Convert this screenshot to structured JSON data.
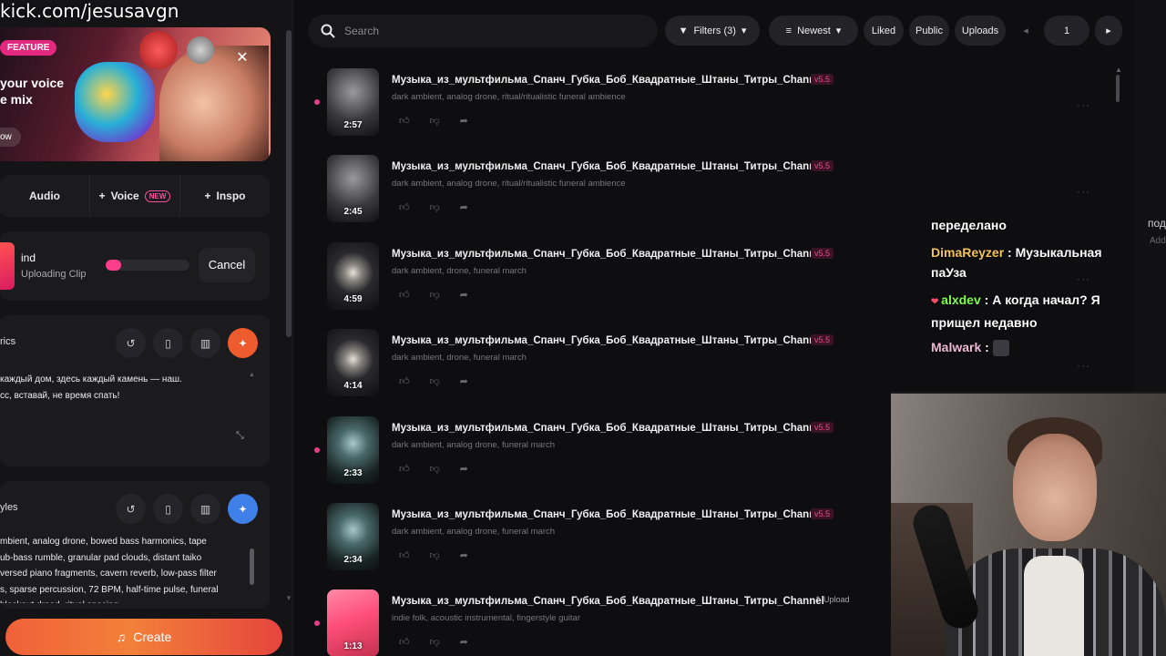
{
  "overlay": {
    "url": "kick.com/jesusavgn"
  },
  "feature": {
    "badge": "FEATURE",
    "title": "your voice\ne mix",
    "button": "ow"
  },
  "tabs": [
    {
      "label": "Audio"
    },
    {
      "label": "Voice",
      "badge": "NEW"
    },
    {
      "label": "Inspo"
    }
  ],
  "upload": {
    "name": "ind",
    "status": "Uploading Clip",
    "progress": 0.18,
    "cancel_label": "Cancel"
  },
  "lyrics": {
    "title": "rics",
    "text": "каждый дом, здесь каждый камень — наш.\nсс, вставай, не время спать!"
  },
  "styles": {
    "title": "yles",
    "text": "mbient, analog drone, bowed bass harmonics, tape\nub-bass rumble, granular pad clouds, distant taiko\nversed piano fragments, cavern reverb, low-pass filter\ns, sparse percussion, 72 BPM, half-time pulse, funeral\nblackout dread, ritual spacing"
  },
  "create_label": "Create",
  "search": {
    "placeholder": "Search"
  },
  "toolbar": {
    "filters": "Filters (3)",
    "sort": "Newest",
    "liked": "Liked",
    "public": "Public",
    "uploads": "Uploads",
    "page": "1"
  },
  "songs": [
    {
      "title": "Музыка_из_мультфильма_Спанч_Губка_Боб_Квадратные_Штаны_Титры_Channel",
      "version": "v5.5",
      "tags": "dark ambient, analog drone, ritual/ritualistic funeral ambience",
      "duration": "2:57",
      "unread": true,
      "thumb": "mountain"
    },
    {
      "title": "Музыка_из_мультфильма_Спанч_Губка_Боб_Квадратные_Штаны_Титры_Channel",
      "version": "v5.5",
      "tags": "dark ambient, analog drone, ritual/ritualistic funeral ambience",
      "duration": "2:45",
      "unread": false,
      "thumb": "mountain"
    },
    {
      "title": "Музыка_из_мультфильма_Спанч_Губка_Боб_Квадратные_Штаны_Титры_Channel",
      "version": "v5.5",
      "tags": "dark ambient, drone, funeral march",
      "duration": "4:59",
      "unread": false,
      "thumb": "egg"
    },
    {
      "title": "Музыка_из_мультфильма_Спанч_Губка_Боб_Квадратные_Штаны_Титры_Channel",
      "version": "v5.5",
      "tags": "dark ambient, drone, funeral march",
      "duration": "4:14",
      "unread": false,
      "thumb": "egg"
    },
    {
      "title": "Музыка_из_мультфильма_Спанч_Губка_Боб_Квадратные_Штаны_Титры_Channel",
      "version": "v5.5",
      "tags": "dark ambient, analog drone, funeral march",
      "duration": "2:33",
      "unread": true,
      "thumb": "bell"
    },
    {
      "title": "Музыка_из_мультфильма_Спанч_Губка_Боб_Квадратные_Штаны_Титры_Channel",
      "version": "v5.5",
      "tags": "dark ambient, analog drone, funeral march",
      "duration": "2:34",
      "unread": false,
      "thumb": "bell"
    },
    {
      "title": "Музыка_из_мультфильма_Спанч_Губка_Боб_Квадратные_Штаны_Титры_Channel",
      "version": "Upload",
      "tags": "indie folk, acoustic instrumental, fingerstyle guitar",
      "duration": "1:13",
      "unread": true,
      "thumb": "pink",
      "is_upload": true
    }
  ],
  "right_panel": {
    "text1": "под",
    "text2": "Add"
  },
  "chat": [
    {
      "user": "",
      "text": "переделано"
    },
    {
      "user": "DimaReyzer",
      "user_color": "#f5c35a",
      "text": "Музыкальная паУза"
    },
    {
      "user": "alxdev",
      "user_color": "#7fff4a",
      "text": "А когда начал? Я прищел недавно"
    },
    {
      "user": "Malwark",
      "user_color": "#f0b8d8",
      "text": ""
    }
  ],
  "colors": {
    "accent": "#e73e8c",
    "create_start": "#f0613a",
    "create_end": "#e6453d"
  }
}
